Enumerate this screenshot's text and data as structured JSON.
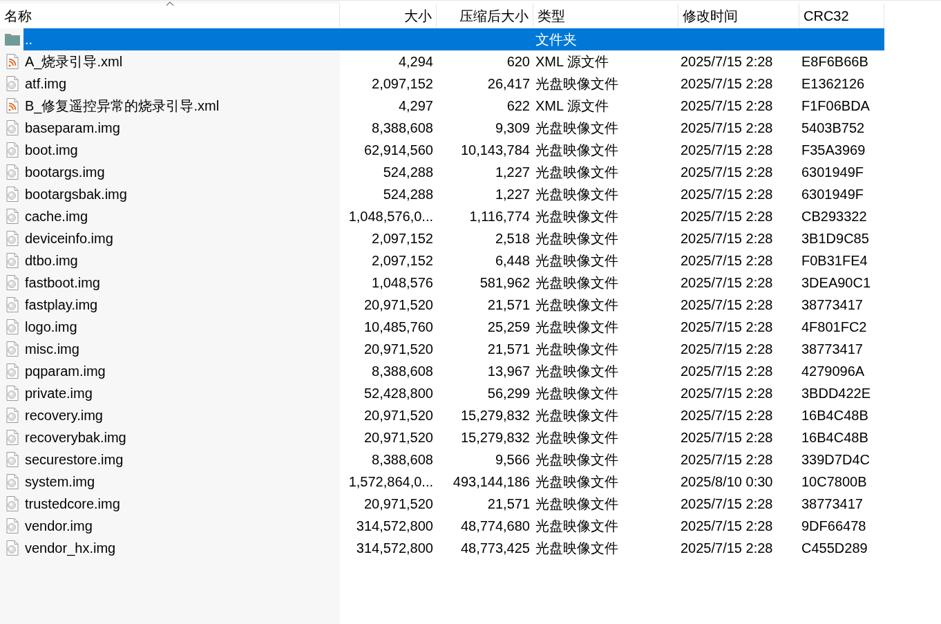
{
  "table": {
    "columns": [
      {
        "label": "名称",
        "sorted": true
      },
      {
        "label": "大小",
        "sorted": false
      },
      {
        "label": "压缩后大小",
        "sorted": false
      },
      {
        "label": "类型",
        "sorted": false
      },
      {
        "label": "修改时间",
        "sorted": false
      },
      {
        "label": "CRC32",
        "sorted": false
      }
    ],
    "rows": [
      {
        "kind": "folder",
        "selected": true,
        "name": "..",
        "type": "文件夹"
      },
      {
        "kind": "xml",
        "selected": false,
        "name": "A_烧录引导.xml",
        "size": "4,294",
        "packed": "620",
        "type": "XML 源文件",
        "modified": "2025/7/15 2:28",
        "crc": "E8F6B66B"
      },
      {
        "kind": "disc",
        "selected": false,
        "name": "atf.img",
        "size": "2,097,152",
        "packed": "26,417",
        "type": "光盘映像文件",
        "modified": "2025/7/15 2:28",
        "crc": "E1362126"
      },
      {
        "kind": "xml",
        "selected": false,
        "name": "B_修复遥控异常的烧录引导.xml",
        "size": "4,297",
        "packed": "622",
        "type": "XML 源文件",
        "modified": "2025/7/15 2:28",
        "crc": "F1F06BDA"
      },
      {
        "kind": "disc",
        "selected": false,
        "name": "baseparam.img",
        "size": "8,388,608",
        "packed": "9,309",
        "type": "光盘映像文件",
        "modified": "2025/7/15 2:28",
        "crc": "5403B752"
      },
      {
        "kind": "disc",
        "selected": false,
        "name": "boot.img",
        "size": "62,914,560",
        "packed": "10,143,784",
        "type": "光盘映像文件",
        "modified": "2025/7/15 2:28",
        "crc": "F35A3969"
      },
      {
        "kind": "disc",
        "selected": false,
        "name": "bootargs.img",
        "size": "524,288",
        "packed": "1,227",
        "type": "光盘映像文件",
        "modified": "2025/7/15 2:28",
        "crc": "6301949F"
      },
      {
        "kind": "disc",
        "selected": false,
        "name": "bootargsbak.img",
        "size": "524,288",
        "packed": "1,227",
        "type": "光盘映像文件",
        "modified": "2025/7/15 2:28",
        "crc": "6301949F"
      },
      {
        "kind": "disc",
        "selected": false,
        "name": "cache.img",
        "size": "1,048,576,0...",
        "packed": "1,116,774",
        "type": "光盘映像文件",
        "modified": "2025/7/15 2:28",
        "crc": "CB293322"
      },
      {
        "kind": "disc",
        "selected": false,
        "name": "deviceinfo.img",
        "size": "2,097,152",
        "packed": "2,518",
        "type": "光盘映像文件",
        "modified": "2025/7/15 2:28",
        "crc": "3B1D9C85"
      },
      {
        "kind": "disc",
        "selected": false,
        "name": "dtbo.img",
        "size": "2,097,152",
        "packed": "6,448",
        "type": "光盘映像文件",
        "modified": "2025/7/15 2:28",
        "crc": "F0B31FE4"
      },
      {
        "kind": "disc",
        "selected": false,
        "name": "fastboot.img",
        "size": "1,048,576",
        "packed": "581,962",
        "type": "光盘映像文件",
        "modified": "2025/7/15 2:28",
        "crc": "3DEA90C1"
      },
      {
        "kind": "disc",
        "selected": false,
        "name": "fastplay.img",
        "size": "20,971,520",
        "packed": "21,571",
        "type": "光盘映像文件",
        "modified": "2025/7/15 2:28",
        "crc": "38773417"
      },
      {
        "kind": "disc",
        "selected": false,
        "name": "logo.img",
        "size": "10,485,760",
        "packed": "25,259",
        "type": "光盘映像文件",
        "modified": "2025/7/15 2:28",
        "crc": "4F801FC2"
      },
      {
        "kind": "disc",
        "selected": false,
        "name": "misc.img",
        "size": "20,971,520",
        "packed": "21,571",
        "type": "光盘映像文件",
        "modified": "2025/7/15 2:28",
        "crc": "38773417"
      },
      {
        "kind": "disc",
        "selected": false,
        "name": "pqparam.img",
        "size": "8,388,608",
        "packed": "13,967",
        "type": "光盘映像文件",
        "modified": "2025/7/15 2:28",
        "crc": "4279096A"
      },
      {
        "kind": "disc",
        "selected": false,
        "name": "private.img",
        "size": "52,428,800",
        "packed": "56,299",
        "type": "光盘映像文件",
        "modified": "2025/7/15 2:28",
        "crc": "3BDD422E"
      },
      {
        "kind": "disc",
        "selected": false,
        "name": "recovery.img",
        "size": "20,971,520",
        "packed": "15,279,832",
        "type": "光盘映像文件",
        "modified": "2025/7/15 2:28",
        "crc": "16B4C48B"
      },
      {
        "kind": "disc",
        "selected": false,
        "name": "recoverybak.img",
        "size": "20,971,520",
        "packed": "15,279,832",
        "type": "光盘映像文件",
        "modified": "2025/7/15 2:28",
        "crc": "16B4C48B"
      },
      {
        "kind": "disc",
        "selected": false,
        "name": "securestore.img",
        "size": "8,388,608",
        "packed": "9,566",
        "type": "光盘映像文件",
        "modified": "2025/7/15 2:28",
        "crc": "339D7D4C"
      },
      {
        "kind": "disc",
        "selected": false,
        "name": "system.img",
        "size": "1,572,864,0...",
        "packed": "493,144,186",
        "type": "光盘映像文件",
        "modified": "2025/8/10 0:30",
        "crc": "10C7800B"
      },
      {
        "kind": "disc",
        "selected": false,
        "name": "trustedcore.img",
        "size": "20,971,520",
        "packed": "21,571",
        "type": "光盘映像文件",
        "modified": "2025/7/15 2:28",
        "crc": "38773417"
      },
      {
        "kind": "disc",
        "selected": false,
        "name": "vendor.img",
        "size": "314,572,800",
        "packed": "48,774,680",
        "type": "光盘映像文件",
        "modified": "2025/7/15 2:28",
        "crc": "9DF66478"
      },
      {
        "kind": "disc",
        "selected": false,
        "name": "vendor_hx.img",
        "size": "314,572,800",
        "packed": "48,773,425",
        "type": "光盘映像文件",
        "modified": "2025/7/15 2:28",
        "crc": "C455D289"
      }
    ]
  }
}
